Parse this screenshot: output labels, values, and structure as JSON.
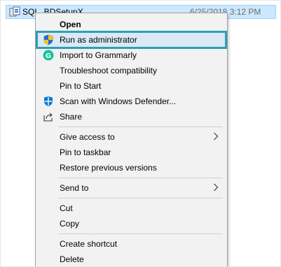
{
  "file": {
    "name": "SQL_BDSetupX",
    "date": "6/25/2018 3:12 PM"
  },
  "menu": {
    "open": "Open",
    "run_as_admin": "Run as administrator",
    "import_grammarly": "Import to Grammarly",
    "troubleshoot": "Troubleshoot compatibility",
    "pin_start": "Pin to Start",
    "scan_defender": "Scan with Windows Defender...",
    "share": "Share",
    "give_access": "Give access to",
    "pin_taskbar": "Pin to taskbar",
    "restore_versions": "Restore previous versions",
    "send_to": "Send to",
    "cut": "Cut",
    "copy": "Copy",
    "create_shortcut": "Create shortcut",
    "delete_partial": "Delete"
  },
  "icons": {
    "uac": "uac-shield-icon",
    "grammarly": "grammarly-icon",
    "defender": "windows-defender-icon",
    "share": "share-icon"
  },
  "colors": {
    "highlight_outline": "#2f9eb5",
    "menu_bg": "#f2f2f2",
    "row_selection": "#cce8ff",
    "grammarly_green": "#15c39a",
    "defender_blue": "#0078d7"
  }
}
